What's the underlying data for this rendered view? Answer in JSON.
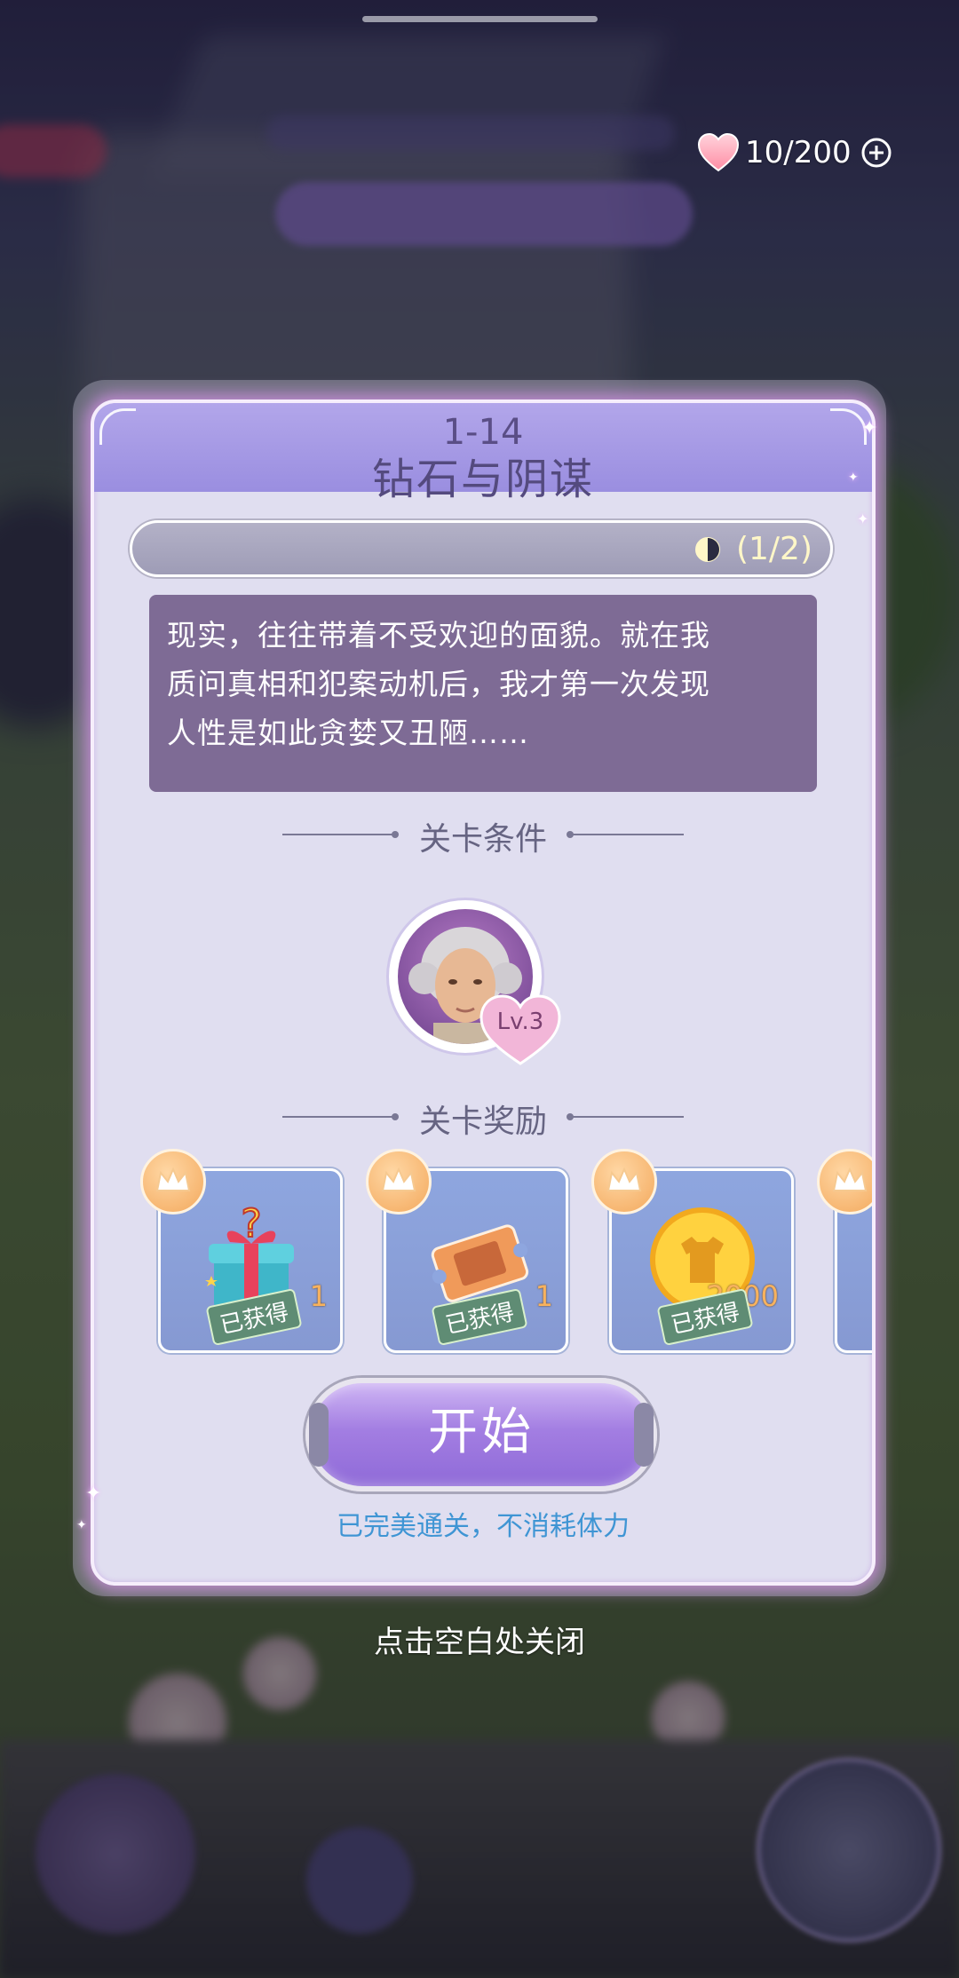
{
  "hud": {
    "stamina_text": "10/200",
    "icons": {
      "stamina": "heart-icon",
      "add": "plus-circle-icon"
    }
  },
  "dialog": {
    "level_number": "1-14",
    "level_title": "钻石与阴谋",
    "progress_text": "(1/2)",
    "progress_icon": "half-moon-icon",
    "story_lines": [
      "现实，往往带着不受欢迎的面貌。就在我",
      "质问真相和犯案动机后，我才第一次发现",
      "人性是如此贪婪又丑陋……"
    ],
    "conditions_heading": "关卡条件",
    "condition": {
      "level_badge": "Lv.3",
      "avatar": "character-portrait"
    },
    "rewards_heading": "关卡奖励",
    "rewards": [
      {
        "icon": "mystery-gift-box-icon",
        "quantity": "1",
        "status": "已获得"
      },
      {
        "icon": "ticket-icon",
        "quantity": "1",
        "status": "已获得"
      },
      {
        "icon": "clothing-coin-icon",
        "quantity": "2000",
        "status": "已获得"
      }
    ],
    "start_label": "开始",
    "perfect_note": "已完美通关，不消耗体力"
  },
  "close_hint": "点击空白处关闭",
  "colors": {
    "dialog_bg": "#e0def0",
    "header": "#9a8ee0",
    "story_bg": "#7e6b95",
    "start_button": "#a37ee2",
    "note_text": "#3f95d4",
    "reward_tile": "#8ea6df",
    "obtained_badge": "#5f8c74"
  }
}
